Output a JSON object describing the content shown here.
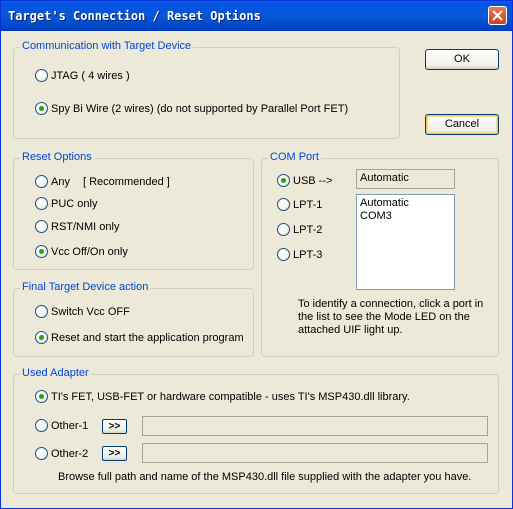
{
  "window": {
    "title": "Target's Connection / Reset Options"
  },
  "buttons": {
    "ok": "OK",
    "cancel": "Cancel"
  },
  "communication": {
    "legend": "Communication with Target Device",
    "jtag": "JTAG ( 4 wires )",
    "spybiwire": "Spy Bi Wire (2 wires) (do not supported by Parallel Port FET)",
    "selected": "spybiwire"
  },
  "reset": {
    "legend": "Reset Options",
    "any": "Any",
    "recommended": "[ Recommended ]",
    "puc": "PUC only",
    "rst": "RST/NMI only",
    "vcc": "Vcc Off/On only",
    "selected": "vcc"
  },
  "final": {
    "legend": "Final Target Device action",
    "switch_off": "Switch Vcc OFF",
    "reset_start": "Reset and start the application program",
    "selected": "reset_start"
  },
  "comport": {
    "legend": "COM Port",
    "usb": "USB -->",
    "lpt1": "LPT-1",
    "lpt2": "LPT-2",
    "lpt3": "LPT-3",
    "selected": "usb",
    "field_value": "Automatic",
    "list_items": [
      "Automatic",
      "COM3"
    ],
    "help": [
      "To identify a connection, click a port in",
      "the list to see the Mode LED on the",
      "attached UIF light up."
    ]
  },
  "adapter": {
    "legend": "Used Adapter",
    "ti": "TI's  FET, USB-FET or hardware compatible - uses TI's MSP430.dll  library.",
    "other1": "Other-1",
    "other2": "Other-2",
    "browse_label": ">>",
    "other1_path": "",
    "other2_path": "",
    "note": "Browse full path and name of the MSP430.dll file supplied with the adapter you have.",
    "selected": "ti"
  },
  "colors": {
    "titlebar": "#0053e1",
    "legend": "#0046d5",
    "radio_dot": "#21a121",
    "dialog_bg": "#ece9d8"
  },
  "icons": {
    "close": "close-icon"
  }
}
